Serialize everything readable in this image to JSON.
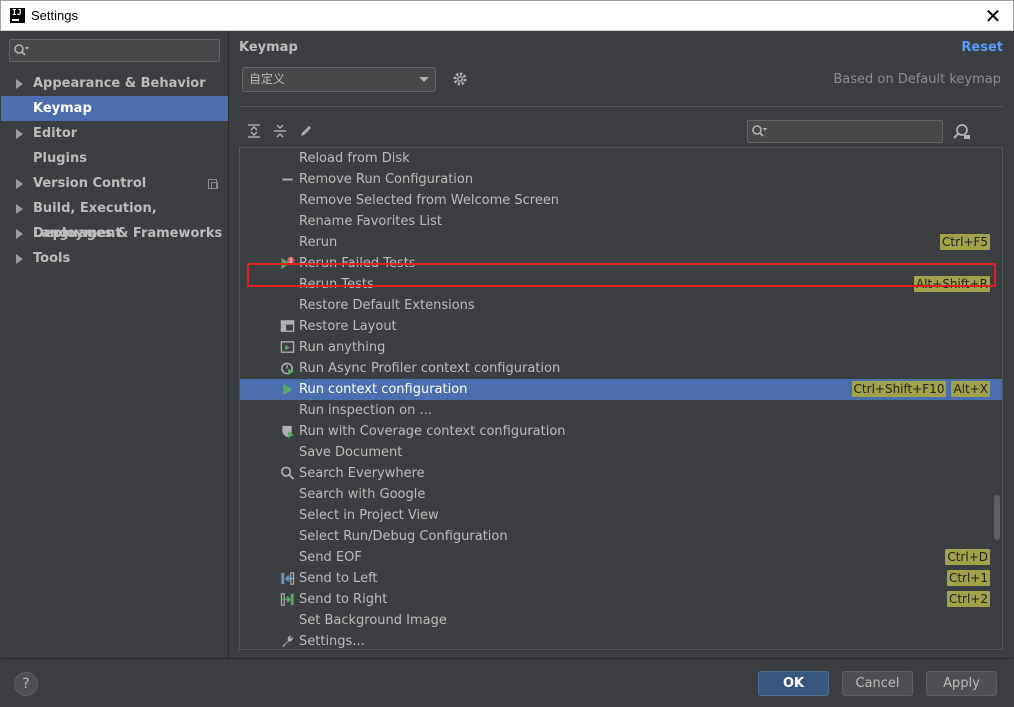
{
  "window": {
    "title": "Settings",
    "app_icon_text": "IJ",
    "close_glyph": "✕"
  },
  "sidebar": {
    "search_placeholder": "",
    "items": [
      {
        "label": "Appearance & Behavior",
        "expandable": true
      },
      {
        "label": "Keymap",
        "selected": true
      },
      {
        "label": "Editor",
        "expandable": true
      },
      {
        "label": "Plugins"
      },
      {
        "label": "Version Control",
        "expandable": true,
        "icon": "copy-icon"
      },
      {
        "label": "Build, Execution, Deployment",
        "expandable": true
      },
      {
        "label": "Languages & Frameworks",
        "expandable": true
      },
      {
        "label": "Tools",
        "expandable": true
      }
    ]
  },
  "keymap": {
    "title": "Keymap",
    "reset_label": "Reset",
    "scheme": "自定义",
    "based_on": "Based on Default keymap",
    "search_placeholder": ""
  },
  "actions": [
    {
      "label": "Reload from Disk",
      "icon": "",
      "shortcuts": []
    },
    {
      "label": "Remove Run Configuration",
      "icon": "minus-icon",
      "shortcuts": []
    },
    {
      "label": "Remove Selected from Welcome Screen",
      "icon": "",
      "shortcuts": []
    },
    {
      "label": "Rename Favorites List",
      "icon": "",
      "shortcuts": []
    },
    {
      "label": "Rerun",
      "icon": "",
      "shortcuts": [
        "Ctrl+F5"
      ]
    },
    {
      "label": "Rerun Failed Tests",
      "icon": "rerun-failed-icon",
      "shortcuts": []
    },
    {
      "label": "Rerun Tests",
      "icon": "",
      "shortcuts": [
        "Alt+Shift+R"
      ]
    },
    {
      "label": "Restore Default Extensions",
      "icon": "",
      "shortcuts": []
    },
    {
      "label": "Restore Layout",
      "icon": "layout-icon",
      "shortcuts": []
    },
    {
      "label": "Run anything",
      "icon": "run-anything-icon",
      "shortcuts": []
    },
    {
      "label": "Run Async Profiler context configuration",
      "icon": "profiler-icon",
      "shortcuts": []
    },
    {
      "label": "Run context configuration",
      "icon": "run-icon",
      "shortcuts": [
        "Ctrl+Shift+F10",
        "Alt+X"
      ],
      "selected": true
    },
    {
      "label": "Run inspection on ...",
      "icon": "",
      "shortcuts": []
    },
    {
      "label": "Run with Coverage context configuration",
      "icon": "coverage-icon",
      "shortcuts": []
    },
    {
      "label": "Save Document",
      "icon": "",
      "shortcuts": []
    },
    {
      "label": "Search Everywhere",
      "icon": "search-icon",
      "shortcuts": []
    },
    {
      "label": "Search with Google",
      "icon": "",
      "shortcuts": []
    },
    {
      "label": "Select in Project View",
      "icon": "",
      "shortcuts": []
    },
    {
      "label": "Select Run/Debug Configuration",
      "icon": "",
      "shortcuts": []
    },
    {
      "label": "Send EOF",
      "icon": "",
      "shortcuts": [
        "Ctrl+D"
      ]
    },
    {
      "label": "Send to Left",
      "icon": "send-left-icon",
      "shortcuts": [
        "Ctrl+1"
      ]
    },
    {
      "label": "Send to Right",
      "icon": "send-right-icon",
      "shortcuts": [
        "Ctrl+2"
      ]
    },
    {
      "label": "Set Background Image",
      "icon": "",
      "shortcuts": []
    },
    {
      "label": "Settings...",
      "icon": "wrench-icon",
      "shortcuts": []
    }
  ],
  "footer": {
    "help_label": "?",
    "ok_label": "OK",
    "cancel_label": "Cancel",
    "apply_label": "Apply"
  },
  "colors": {
    "selection": "#4b6eaf",
    "shortcut_badge": "#a1a14a",
    "link": "#589df6",
    "highlight_border": "#e02020"
  }
}
